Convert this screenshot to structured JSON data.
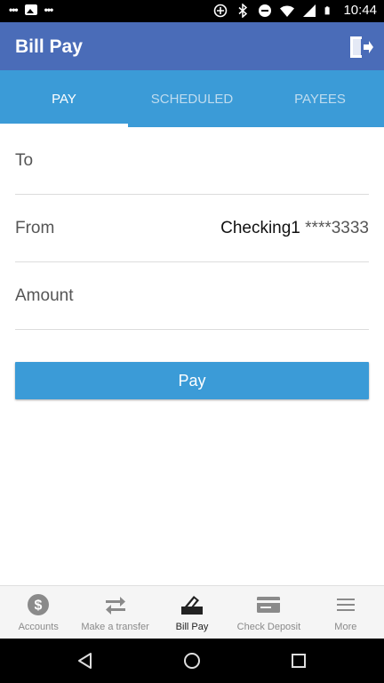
{
  "status_bar": {
    "time": "10:44"
  },
  "app_bar": {
    "title": "Bill Pay",
    "icon": "logout-icon"
  },
  "tabs": [
    {
      "label": "PAY",
      "active": true
    },
    {
      "label": "SCHEDULED",
      "active": false
    },
    {
      "label": "PAYEES",
      "active": false
    }
  ],
  "form": {
    "to": {
      "label": "To",
      "value": ""
    },
    "from": {
      "label": "From",
      "account": "Checking1",
      "mask": "****3333"
    },
    "amount": {
      "label": "Amount",
      "value": ""
    }
  },
  "pay_button": {
    "label": "Pay"
  },
  "bottom_nav": [
    {
      "label": "Accounts",
      "icon": "dollar-icon",
      "active": false
    },
    {
      "label": "Make a transfer",
      "icon": "transfer-icon",
      "active": false
    },
    {
      "label": "Bill Pay",
      "icon": "bill-pay-icon",
      "active": true
    },
    {
      "label": "Check Deposit",
      "icon": "check-deposit-icon",
      "active": false
    },
    {
      "label": "More",
      "icon": "menu-icon",
      "active": false
    }
  ],
  "colors": {
    "app_bar": "#4a6cb8",
    "accent": "#3b9bd7"
  }
}
